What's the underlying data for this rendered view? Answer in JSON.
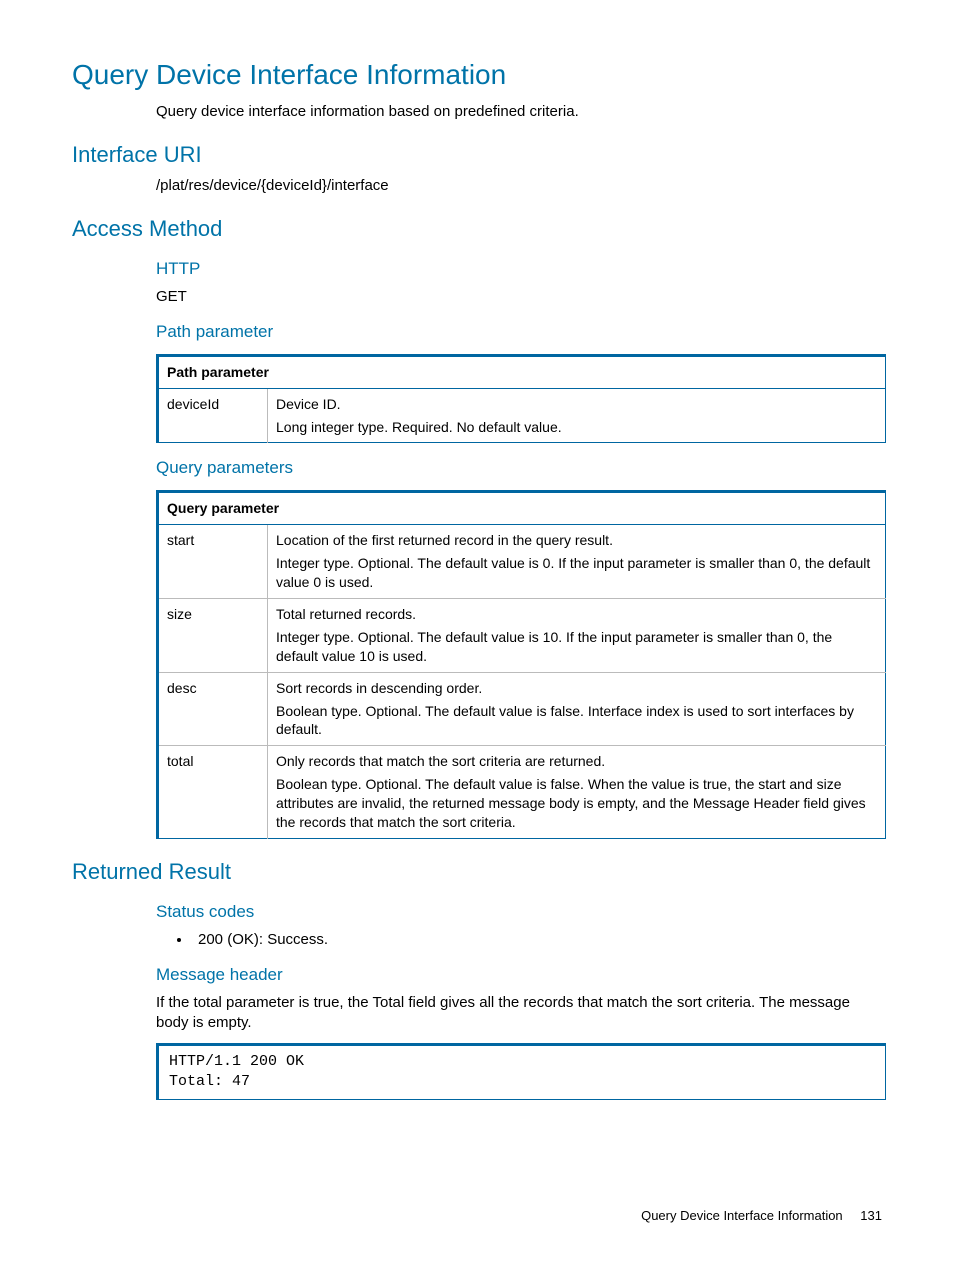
{
  "title": "Query Device Interface Information",
  "intro": "Query device interface information based on predefined criteria.",
  "sections": {
    "interface_uri": {
      "heading": "Interface URI",
      "value": "/plat/res/device/{deviceId}/interface"
    },
    "access_method": {
      "heading": "Access Method",
      "http": {
        "heading": "HTTP",
        "value": "GET"
      },
      "path_param": {
        "heading": "Path parameter",
        "table_header": "Path parameter",
        "rows": [
          {
            "name": "deviceId",
            "desc1": "Device ID.",
            "desc2": "Long integer type. Required. No default value."
          }
        ]
      },
      "query_params": {
        "heading": "Query parameters",
        "table_header": "Query parameter",
        "rows": [
          {
            "name": "start",
            "desc1": "Location of the first returned record in the query result.",
            "desc2": "Integer type. Optional. The default value is 0. If the input parameter is smaller than 0, the default value 0 is used."
          },
          {
            "name": "size",
            "desc1": "Total returned records.",
            "desc2": "Integer type. Optional. The default value is 10. If the input parameter is smaller than 0, the default value 10 is used."
          },
          {
            "name": "desc",
            "desc1": "Sort records in descending order.",
            "desc2": "Boolean type. Optional. The default value is false. Interface index is used to sort interfaces by default."
          },
          {
            "name": "total",
            "desc1": "Only records that match the sort criteria are returned.",
            "desc2": "Boolean type. Optional. The default value is false. When the value is true, the start and size attributes are invalid, the returned message body is empty, and the Message Header field gives the records that match the sort criteria."
          }
        ]
      }
    },
    "returned_result": {
      "heading": "Returned Result",
      "status_codes": {
        "heading": "Status codes",
        "bullet": "200 (OK): Success."
      },
      "message_header": {
        "heading": "Message header",
        "text": "If the total parameter is true, the Total field gives all the records that match the sort criteria. The message body is empty.",
        "code": "HTTP/1.1 200 OK\nTotal: 47"
      }
    }
  },
  "footer": {
    "title": "Query Device Interface Information",
    "page": "131"
  }
}
